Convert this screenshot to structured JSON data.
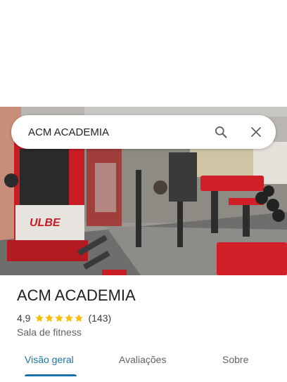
{
  "search": {
    "query": "ACM ACADEMIA",
    "search_icon": "search-icon",
    "close_icon": "close-icon"
  },
  "place": {
    "name": "ACM ACADEMIA",
    "rating": "4,9",
    "stars": 5,
    "star_color": "#fbbc04",
    "review_count": "(143)",
    "category": "Sala de fitness"
  },
  "photo": {
    "machine_brand": "ULBE"
  },
  "tabs": [
    {
      "label": "Visão geral",
      "active": true
    },
    {
      "label": "Avaliações",
      "active": false
    },
    {
      "label": "Sobre",
      "active": false
    }
  ],
  "colors": {
    "accent": "#1a73a8",
    "equipment_red": "#d32027"
  }
}
